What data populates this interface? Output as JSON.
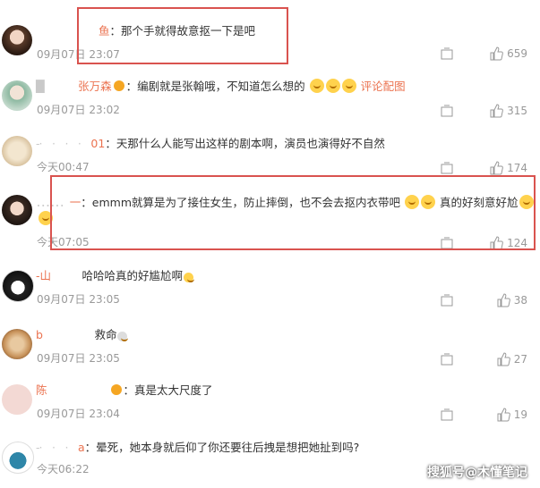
{
  "comments": [
    {
      "user": "鱼",
      "text": "那个手就得故意抠一下是吧",
      "time": "09月07日 23:07",
      "likes": "659"
    },
    {
      "user": "张万森",
      "text": "编剧就是张翰哦，不知道怎么想的",
      "link": "评论配图",
      "time": "09月07日 23:02",
      "likes": "315"
    },
    {
      "user": "01",
      "text": "天那什么人能写出这样的剧本啊，演员也演得好不自然",
      "time": "今天00:47",
      "likes": "174"
    },
    {
      "user": "一",
      "text": "emmm就算是为了接住女生，防止摔倒，也不会去抠内衣带吧",
      "text2": "真的好刻意好尬",
      "time": "今天07:05",
      "likes": "124"
    },
    {
      "user": "山",
      "text": "哈哈哈真的好尴尬啊",
      "time": "09月07日 23:05",
      "likes": "38"
    },
    {
      "user": "b",
      "text": "救命",
      "time": "09月07日 23:05",
      "likes": "27"
    },
    {
      "user": "陈",
      "text": "真是太大尺度了",
      "time": "09月07日 23:04",
      "likes": "19"
    },
    {
      "user": "a",
      "text": "晕死，她本身就后仰了你还要往后拽是想把她扯到吗?",
      "time": "今天06:22",
      "likes": ""
    }
  ],
  "watermark": "搜狐号@木懂笔记",
  "colors": {
    "username": "#eb7350",
    "highlight_box": "#d9534f"
  }
}
